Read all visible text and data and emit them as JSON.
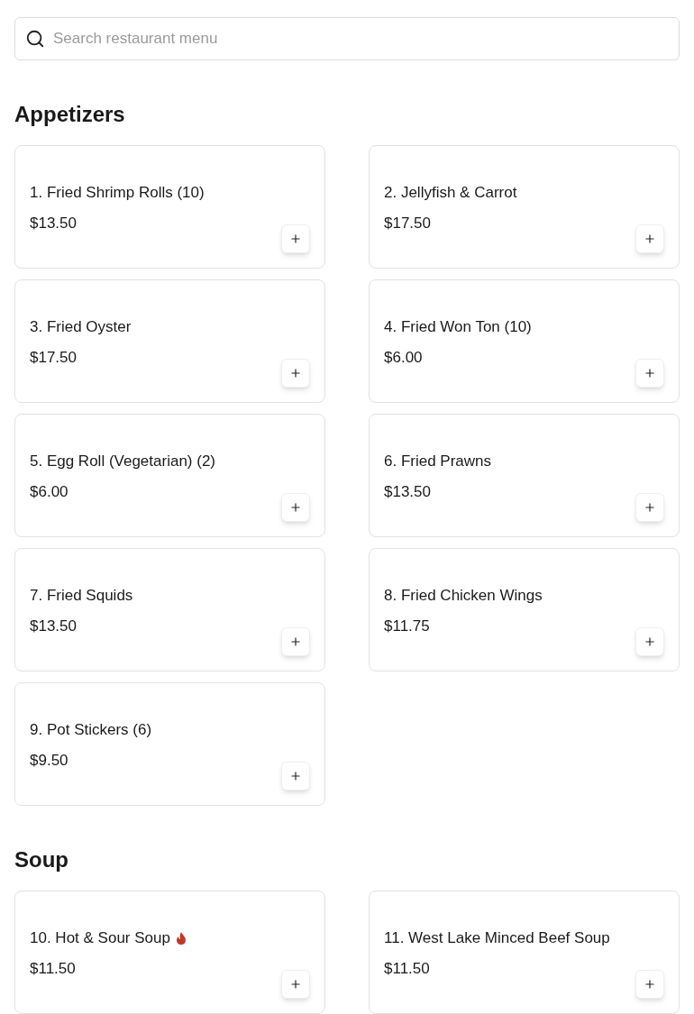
{
  "search": {
    "placeholder": "Search restaurant menu"
  },
  "sections": [
    {
      "title": "Appetizers",
      "items": [
        {
          "name": "1. Fried Shrimp Rolls (10)",
          "price": "$13.50",
          "spicy": false
        },
        {
          "name": "2. Jellyfish & Carrot",
          "price": "$17.50",
          "spicy": false
        },
        {
          "name": "3. Fried Oyster",
          "price": "$17.50",
          "spicy": false
        },
        {
          "name": "4. Fried Won Ton (10)",
          "price": "$6.00",
          "spicy": false
        },
        {
          "name": "5. Egg Roll (Vegetarian) (2)",
          "price": "$6.00",
          "spicy": false
        },
        {
          "name": "6. Fried Prawns",
          "price": "$13.50",
          "spicy": false
        },
        {
          "name": "7. Fried Squids",
          "price": "$13.50",
          "spicy": false
        },
        {
          "name": "8. Fried Chicken Wings",
          "price": "$11.75",
          "spicy": false
        },
        {
          "name": "9. Pot Stickers (6)",
          "price": "$9.50",
          "spicy": false
        }
      ]
    },
    {
      "title": "Soup",
      "items": [
        {
          "name": "10. Hot & Sour Soup",
          "price": "$11.50",
          "spicy": true
        },
        {
          "name": "11. West Lake Minced Beef Soup",
          "price": "$11.50",
          "spicy": false
        }
      ]
    }
  ]
}
